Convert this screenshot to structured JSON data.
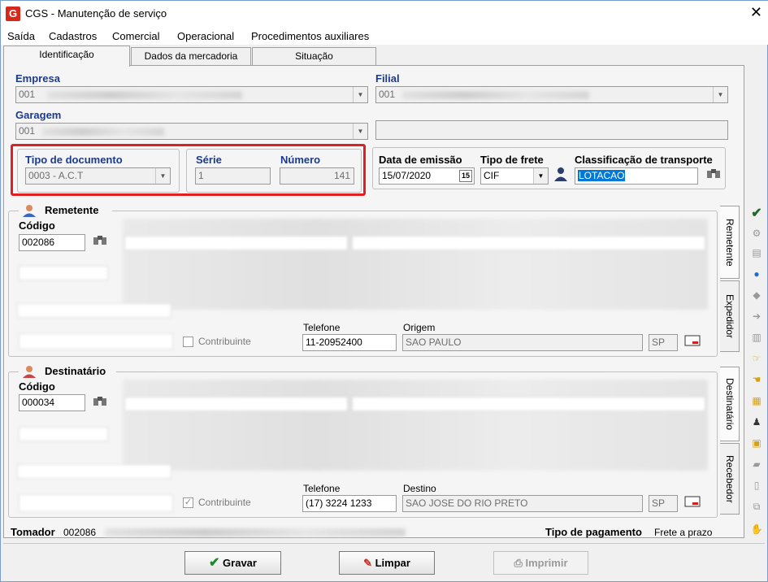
{
  "window": {
    "title": "CGS - Manutenção de serviço",
    "close": "✕",
    "logo": "G"
  },
  "menu": [
    "Saída",
    "Cadastros",
    "Comercial",
    "Operacional",
    "Procedimentos auxiliares"
  ],
  "tabs": [
    "Identificação",
    "Dados da mercadoria",
    "Situação"
  ],
  "empresa": {
    "label": "Empresa",
    "value": "001"
  },
  "filial": {
    "label": "Filial",
    "value": "001"
  },
  "garagem": {
    "label": "Garagem",
    "value": "001"
  },
  "tipo_documento": {
    "label": "Tipo de documento",
    "value": "0003 - A.C.T"
  },
  "serie": {
    "label": "Série",
    "value": "1"
  },
  "numero": {
    "label": "Número",
    "value": "141"
  },
  "data_emissao": {
    "label": "Data de emissão",
    "value": "15/07/2020"
  },
  "tipo_frete": {
    "label": "Tipo de frete",
    "value": "CIF"
  },
  "classificacao": {
    "label": "Classificação de transporte",
    "value": "LOTACAO"
  },
  "remetente": {
    "title": "Remetente",
    "codigo_label": "Código",
    "codigo": "002086",
    "contribuinte": "Contribuinte",
    "telefone_label": "Telefone",
    "telefone": "11-20952400",
    "cidade_label": "Origem",
    "cidade": "SAO PAULO",
    "uf": "SP"
  },
  "destinatario": {
    "title": "Destinatário",
    "codigo_label": "Código",
    "codigo": "000034",
    "contribuinte": "Contribuinte",
    "telefone_label": "Telefone",
    "telefone": "(17) 3224 1233",
    "cidade_label": "Destino",
    "cidade": "SAO JOSE DO RIO PRETO",
    "uf": "SP"
  },
  "side_tabs": [
    "Remetente",
    "Expedidor",
    "Destinatário",
    "Recebedor"
  ],
  "tomador": {
    "label": "Tomador",
    "value": "002086"
  },
  "pagamento": {
    "label": "Tipo de pagamento",
    "value": "Frete a prazo"
  },
  "buttons": {
    "gravar": "Gravar",
    "limpar": "Limpar",
    "imprimir": "Imprimir"
  },
  "colors": {
    "accent": "#1c3a8a",
    "highlight": "#e02020",
    "selection": "#0078d7"
  },
  "icons": [
    "binoculars-icon",
    "calendar-icon",
    "person-icon",
    "check-icon",
    "globe-icon",
    "envelope-icon"
  ]
}
